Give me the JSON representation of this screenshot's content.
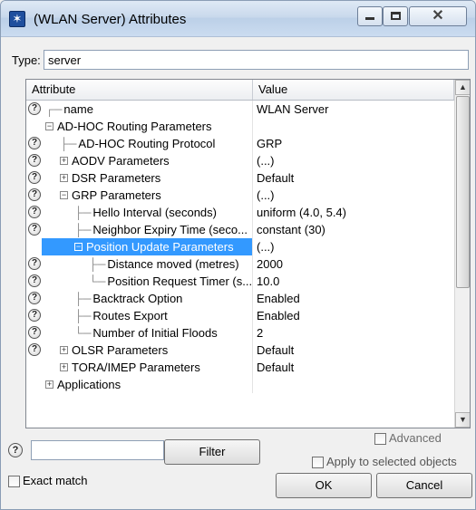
{
  "window": {
    "title": "(WLAN Server) Attributes",
    "icon": "app-icon",
    "app_icon_glyph": "✶"
  },
  "type_field": {
    "label": "Type:",
    "value": "server"
  },
  "table": {
    "columns": [
      "Attribute",
      "Value"
    ],
    "rows": [
      {
        "help": true,
        "indent": 0,
        "prefix": "┌",
        "expander": "",
        "attribute": "name",
        "value": "WLAN Server"
      },
      {
        "help": false,
        "indent": 0,
        "prefix": "",
        "expander": "⊟",
        "attribute": "AD-HOC Routing Parameters",
        "value": ""
      },
      {
        "help": true,
        "indent": 1,
        "prefix": "├",
        "expander": "",
        "attribute": "AD-HOC Routing Protocol",
        "value": "GRP"
      },
      {
        "help": true,
        "indent": 1,
        "prefix": "",
        "expander": "⊞",
        "attribute": "AODV Parameters",
        "value": "(...)"
      },
      {
        "help": true,
        "indent": 1,
        "prefix": "",
        "expander": "⊞",
        "attribute": "DSR Parameters",
        "value": "Default"
      },
      {
        "help": true,
        "indent": 1,
        "prefix": "",
        "expander": "⊟",
        "attribute": "GRP Parameters",
        "value": "(...)"
      },
      {
        "help": true,
        "indent": 2,
        "prefix": "├",
        "expander": "",
        "attribute": "Hello Interval (seconds)",
        "value": "uniform (4.0, 5.4)"
      },
      {
        "help": true,
        "indent": 2,
        "prefix": "├",
        "expander": "",
        "attribute": "Neighbor Expiry Time (seco...",
        "value": "constant (30)"
      },
      {
        "help": false,
        "indent": 2,
        "prefix": "",
        "expander": "⊟",
        "attribute": "Position Update Parameters",
        "value": "(...)",
        "selected": true
      },
      {
        "help": true,
        "indent": 3,
        "prefix": "├",
        "expander": "",
        "attribute": "Distance moved (metres)",
        "value": "2000"
      },
      {
        "help": true,
        "indent": 3,
        "prefix": "└",
        "expander": "",
        "attribute": "Position Request Timer (s...",
        "value": "10.0"
      },
      {
        "help": true,
        "indent": 2,
        "prefix": "├",
        "expander": "",
        "attribute": "Backtrack Option",
        "value": "Enabled"
      },
      {
        "help": true,
        "indent": 2,
        "prefix": "├",
        "expander": "",
        "attribute": "Routes Export",
        "value": "Enabled"
      },
      {
        "help": true,
        "indent": 2,
        "prefix": "└",
        "expander": "",
        "attribute": "Number of Initial Floods",
        "value": "2"
      },
      {
        "help": true,
        "indent": 1,
        "prefix": "",
        "expander": "⊞",
        "attribute": "OLSR Parameters",
        "value": "Default"
      },
      {
        "help": false,
        "indent": 1,
        "prefix": "",
        "expander": "⊞",
        "attribute": "TORA/IMEP Parameters",
        "value": "Default"
      },
      {
        "help": false,
        "indent": 0,
        "prefix": "",
        "expander": "⊞",
        "attribute": "Applications",
        "value": ""
      }
    ]
  },
  "bottom": {
    "filter_value": "",
    "filter_button": "Filter",
    "exact_match": "Exact match",
    "advanced": "Advanced",
    "apply_selected": "Apply to selected objects",
    "ok": "OK",
    "cancel": "Cancel"
  }
}
